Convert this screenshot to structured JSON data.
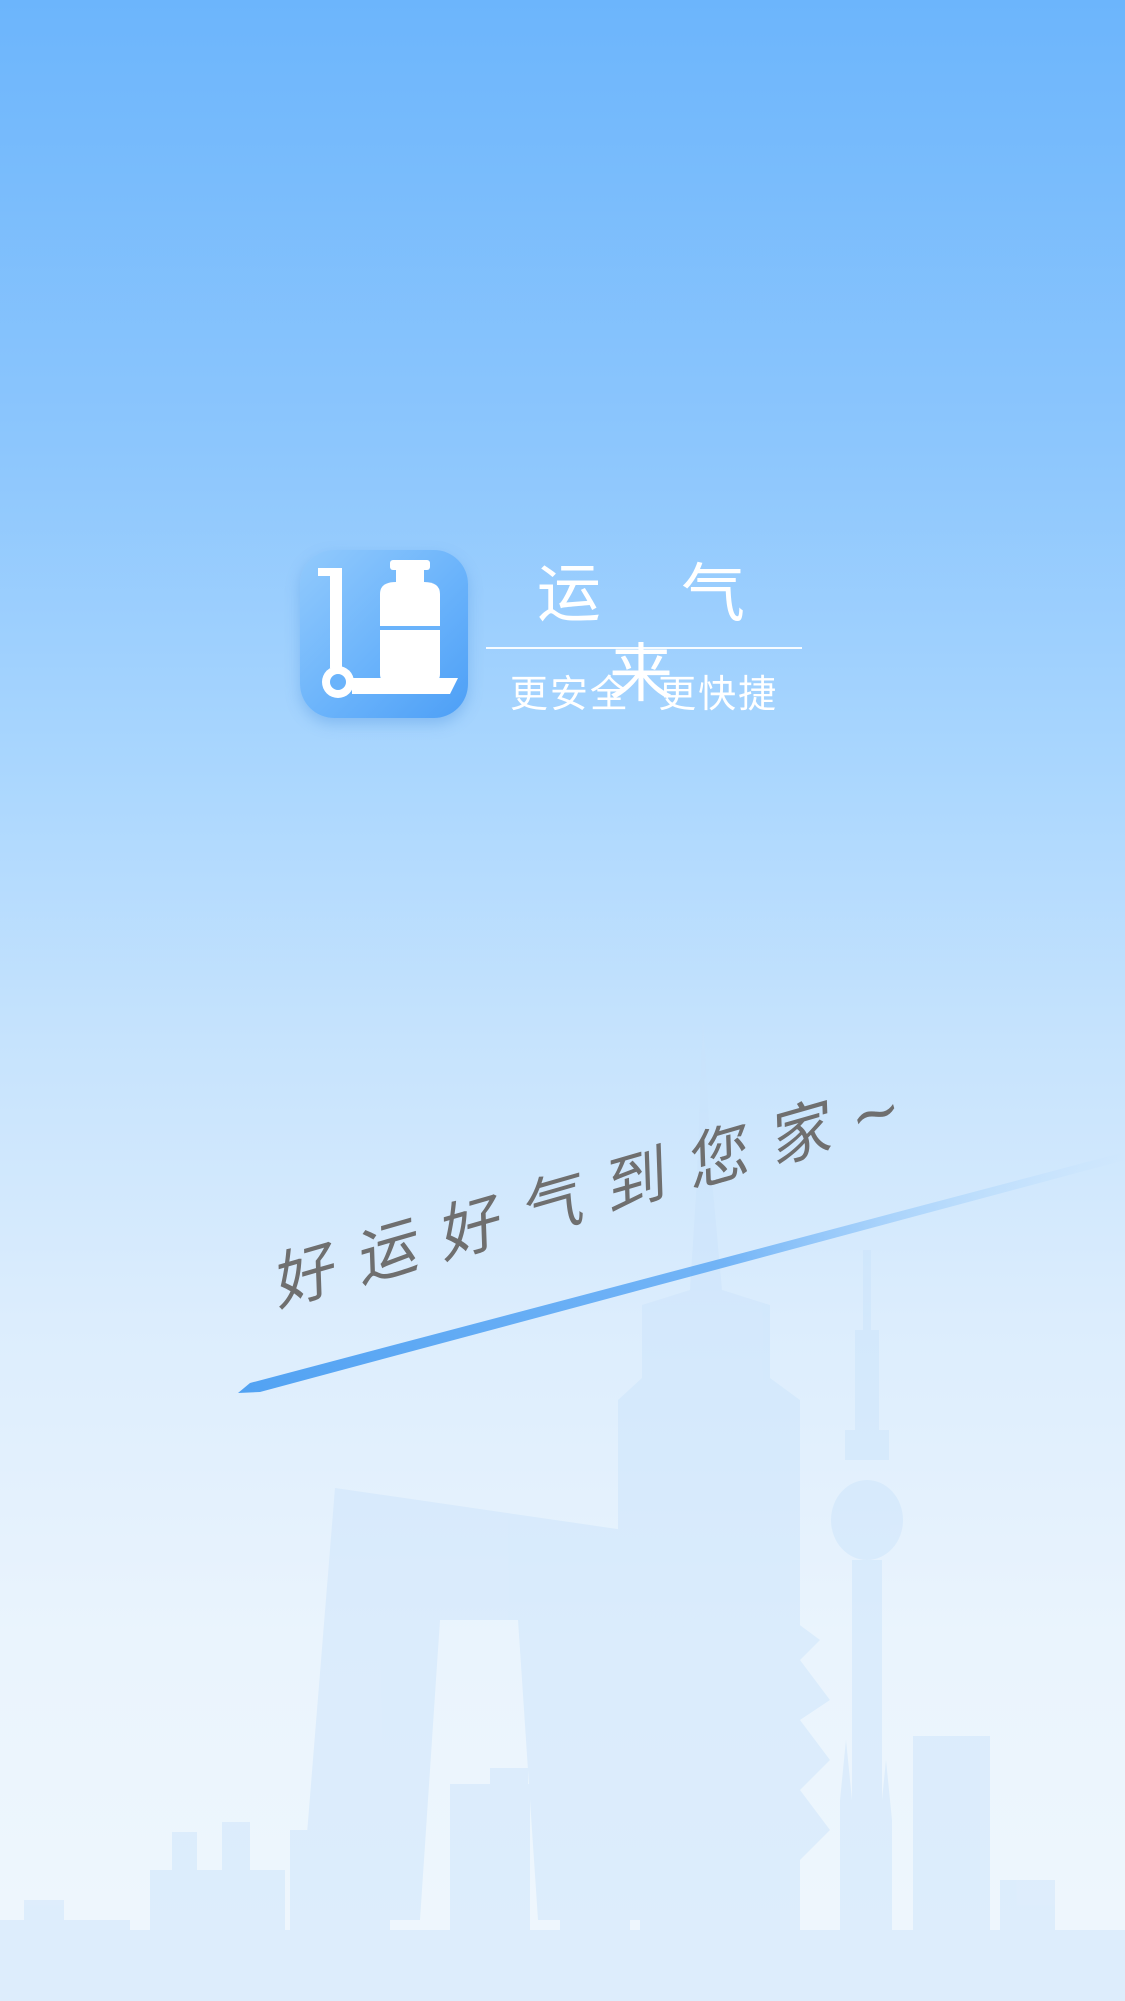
{
  "app": {
    "name": "运 气 来",
    "tagline": "更安全  更快捷"
  },
  "slogan": "好运好气到您家~",
  "icons": {
    "app_icon": "gas-cylinder-hand-truck-icon",
    "background": "city-skyline-illustration"
  },
  "colors": {
    "sky_top": "#6cb5fc",
    "sky_bottom": "#eff7fd",
    "icon_blue": "#6ab3fb",
    "streak_blue": "#4a9ef2",
    "slogan_gray": "#6f6f6f"
  }
}
